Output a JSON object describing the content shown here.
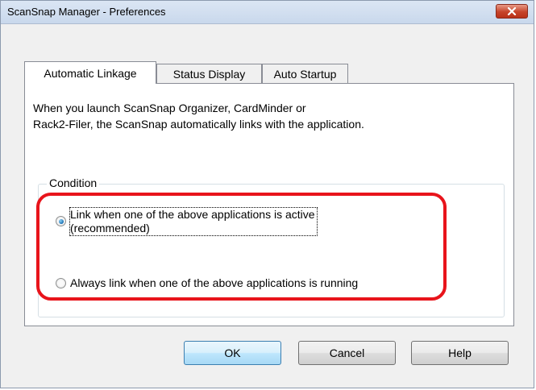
{
  "window": {
    "title": "ScanSnap Manager - Preferences"
  },
  "tabs": [
    {
      "label": "Automatic Linkage",
      "active": true
    },
    {
      "label": "Status Display",
      "active": false
    },
    {
      "label": "Auto Startup",
      "active": false
    }
  ],
  "panel": {
    "description_line1": "When you launch ScanSnap Organizer, CardMinder or",
    "description_line2": "Rack2-Filer, the ScanSnap automatically links with the application.",
    "group_label": "Condition",
    "options": [
      {
        "line1": "Link when one of the above applications is active",
        "line2": "(recommended)",
        "checked": true
      },
      {
        "line1": "Always link when one of the above applications is running",
        "checked": false
      }
    ]
  },
  "buttons": {
    "ok": "OK",
    "cancel": "Cancel",
    "help": "Help"
  },
  "colors": {
    "highlight": "#e8141b",
    "close_button": "#c6432a",
    "default_button": "#3c7fb1"
  },
  "icons": {
    "close": "close-icon"
  }
}
